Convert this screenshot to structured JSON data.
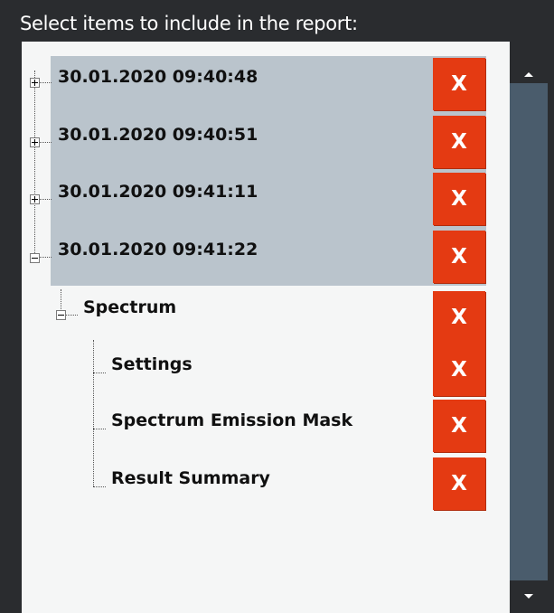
{
  "header": {
    "title": "Select items to include in the report:"
  },
  "tree": {
    "items": [
      {
        "label": "30.01.2020 09:40:48",
        "expander": "+",
        "delete_label": "X"
      },
      {
        "label": "30.01.2020 09:40:51",
        "expander": "+",
        "delete_label": "X"
      },
      {
        "label": "30.01.2020 09:41:11",
        "expander": "+",
        "delete_label": "X"
      },
      {
        "label": "30.01.2020 09:41:22",
        "expander": "-",
        "delete_label": "X"
      },
      {
        "label": "Spectrum",
        "expander": "-",
        "delete_label": "X"
      },
      {
        "label": "Settings",
        "delete_label": "X"
      },
      {
        "label": "Spectrum Emission Mask",
        "delete_label": "X"
      },
      {
        "label": "Result Summary",
        "delete_label": "X"
      }
    ]
  },
  "colors": {
    "background": "#2a2c2f",
    "list_background": "#f5f6f6",
    "selected_row": "#bac4cc",
    "delete_button": "#e43a12",
    "scroll_track": "#4a5c6c"
  },
  "icons": {
    "scroll_up": "triangle-up-icon",
    "scroll_down": "triangle-down-icon",
    "expand": "plus-box-icon",
    "collapse": "minus-box-icon"
  }
}
